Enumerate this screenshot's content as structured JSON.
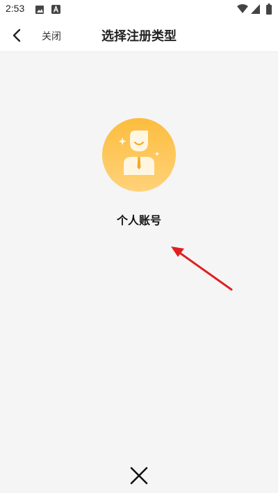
{
  "status_bar": {
    "time": "2:53",
    "icons": [
      "image-icon",
      "a-badge-icon",
      "wifi-icon",
      "signal-icon",
      "battery-icon"
    ]
  },
  "nav": {
    "back_icon": "chevron-left-icon",
    "close_label": "关闭",
    "title": "选择注册类型"
  },
  "options": [
    {
      "label": "个人账号",
      "icon": "person-avatar-icon"
    }
  ],
  "dismiss": {
    "icon": "close-x-icon"
  },
  "colors": {
    "avatar_top": "#fcbd3e",
    "avatar_bottom": "#ffd27a",
    "annotation_arrow": "#e02020",
    "background": "#f5f5f5"
  }
}
